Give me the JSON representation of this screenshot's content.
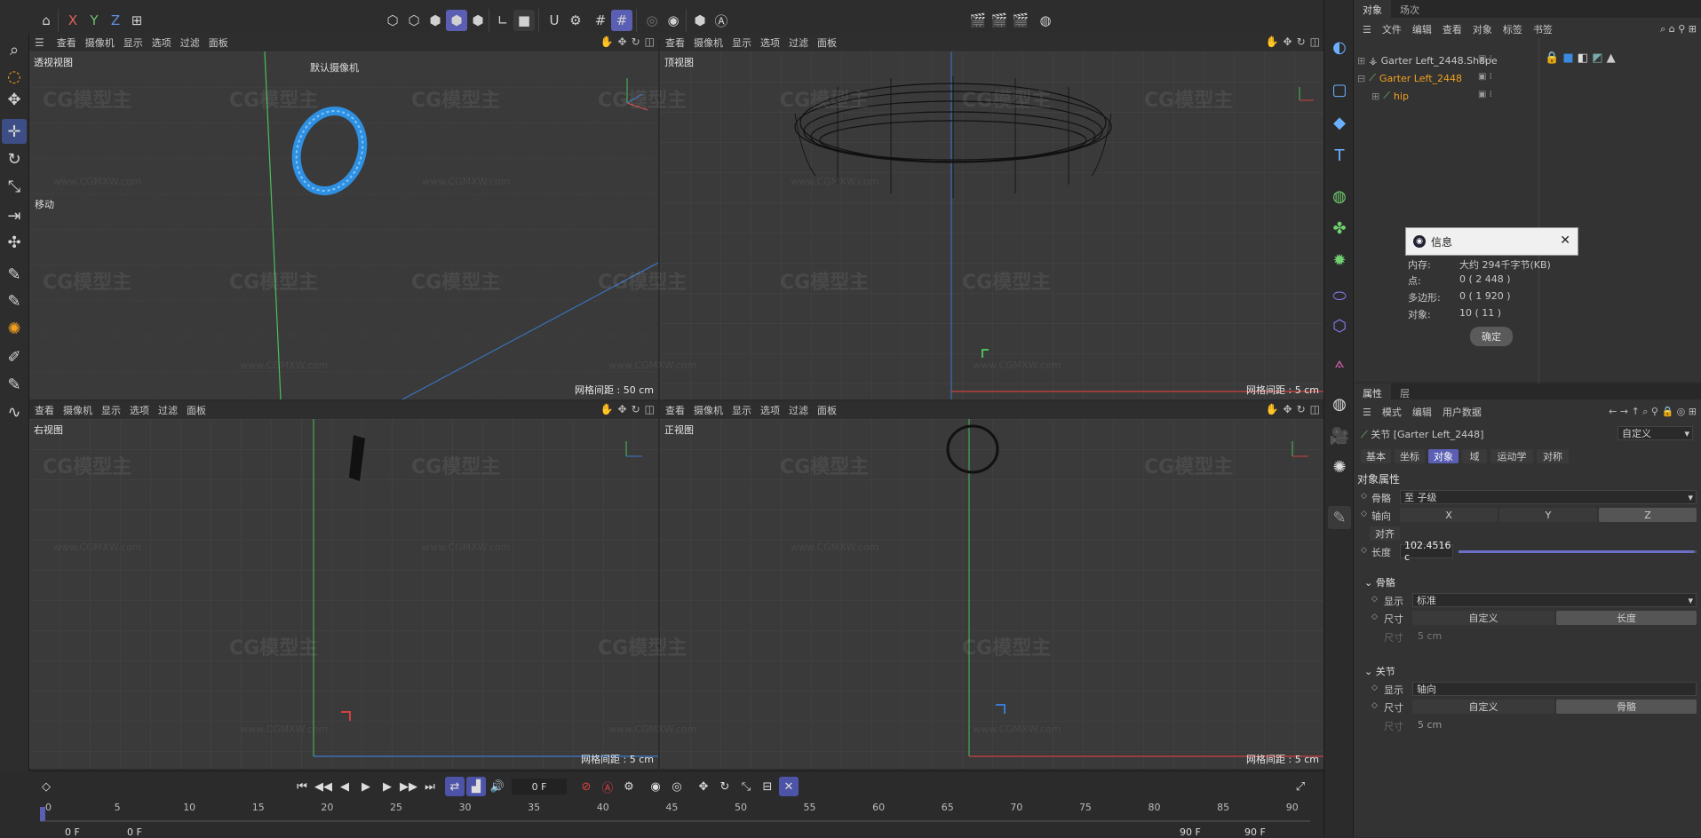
{
  "toolbar": {
    "axis_x": "X",
    "axis_y": "Y",
    "axis_z": "Z"
  },
  "viewports": [
    {
      "label": "透视视图",
      "camera": "默认摄像机",
      "grid": "网格间距 : 50 cm",
      "move": "移动"
    },
    {
      "label": "顶视图",
      "grid": "网格间距 : 5 cm"
    },
    {
      "label": "右视图",
      "grid": "网格间距 : 5 cm"
    },
    {
      "label": "正视图",
      "grid": "网格间距 : 5 cm"
    }
  ],
  "vp_menu": {
    "view": "查看",
    "camera": "摄像机",
    "display": "显示",
    "options": "选项",
    "filter": "过滤",
    "panel": "面板"
  },
  "watermark": {
    "logo": "CG模型主",
    "url": "www.CGMXW.com"
  },
  "timeline": {
    "frame": "0 F",
    "start1": "0 F",
    "start2": "0 F",
    "end1": "90 F",
    "end2": "90 F",
    "ticks": [
      "0",
      "5",
      "10",
      "15",
      "20",
      "25",
      "30",
      "35",
      "40",
      "45",
      "50",
      "55",
      "60",
      "65",
      "70",
      "75",
      "80",
      "85",
      "90"
    ]
  },
  "objects_panel": {
    "tab_objects": "对象",
    "tab_scene": "场次",
    "menu": [
      "文件",
      "编辑",
      "查看",
      "对象",
      "标签",
      "书签"
    ],
    "items": [
      {
        "name": "Garter Left_2448.Shape",
        "color": "#c8c8c8"
      },
      {
        "name": "Garter Left_2448",
        "color": "#f0a020"
      },
      {
        "name": "hip",
        "color": "#f0a020"
      }
    ]
  },
  "info_dialog": {
    "title": "信息",
    "rows": [
      {
        "k": "内存:",
        "v": "大约 294千字节(KB)"
      },
      {
        "k": "点:",
        "v": "0 ( 2 448 )"
      },
      {
        "k": "多边形:",
        "v": "0 ( 1 920 )"
      },
      {
        "k": "对象:",
        "v": "10 ( 11 )"
      }
    ],
    "ok": "确定"
  },
  "attributes": {
    "tab_attr": "属性",
    "tab_layer": "层",
    "menu": [
      "模式",
      "编辑",
      "用户数据"
    ],
    "title": "关节 [Garter Left_2448]",
    "preset": "自定义",
    "tabs": [
      "基本",
      "坐标",
      "对象",
      "域",
      "运动学",
      "对称"
    ],
    "section": "对象属性",
    "bone_label": "骨骼",
    "bone_value": "至 子级",
    "axis_label": "轴向",
    "axis_x": "X",
    "axis_y": "Y",
    "axis_z": "Z",
    "align": "对齐",
    "length_label": "长度",
    "length_value": "102.4516 c",
    "length_fraction": 0.99,
    "bones_group": "骨骼",
    "display_label": "显示",
    "display_value": "标准",
    "size_label": "尺寸",
    "size_custom": "自定义",
    "size_length": "长度",
    "size_sub": "尺寸",
    "size_sub_value": "5 cm",
    "joint_group": "关节",
    "j_display_value": "轴向",
    "j_size_bone": "骨骼"
  },
  "accent": "#5a5fb3"
}
